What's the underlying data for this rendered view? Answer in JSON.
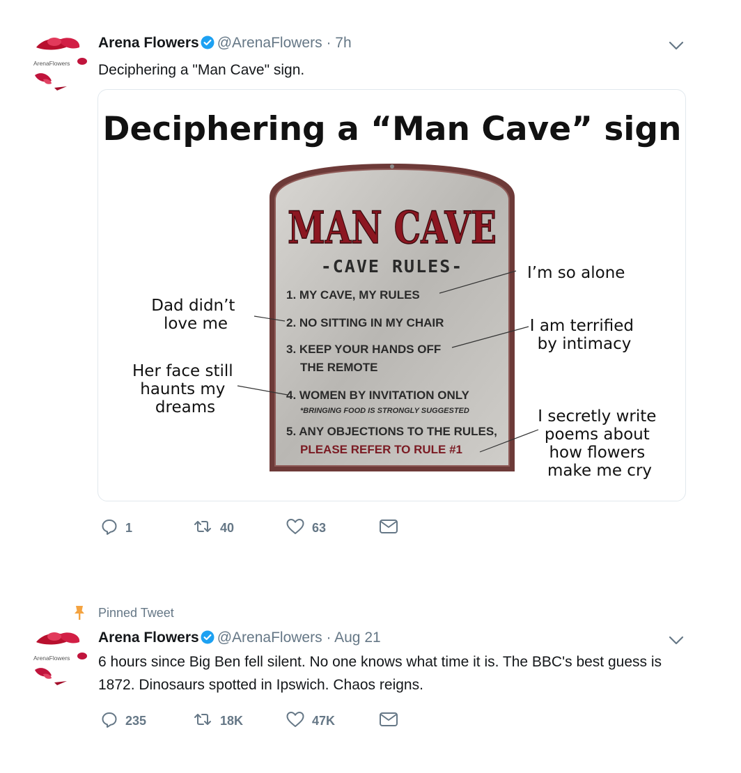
{
  "tweets": [
    {
      "account": {
        "name": "Arena Flowers",
        "handle": "@ArenaFlowers",
        "avatar_logo_text": "ArenaFlowers"
      },
      "time": "7h",
      "text": "Deciphering a \"Man Cave\" sign.",
      "media": {
        "title": "Deciphering a “Man Cave” sign",
        "sign": {
          "heading": "MAN CAVE",
          "subheading": "-CAVE RULES-",
          "rules": [
            "1. MY CAVE, MY RULES",
            "2. NO SITTING IN MY CHAIR",
            "3. KEEP YOUR HANDS OFF",
            "THE REMOTE",
            "4. WOMEN BY INVITATION ONLY",
            "*BRINGING FOOD IS STRONGLY SUGGESTED",
            "5. ANY OBJECTIONS TO THE RULES,",
            "PLEASE REFER TO RULE #1"
          ]
        },
        "annotations": {
          "left1": [
            "Dad didn’t",
            "love me"
          ],
          "left2": [
            "Her face still",
            "haunts my",
            "dreams"
          ],
          "right1": [
            "I’m so alone"
          ],
          "right2": [
            "I am terrified",
            "by intimacy"
          ],
          "right3": [
            "I secretly write",
            "poems about",
            "how flowers",
            "make me cry"
          ]
        }
      },
      "stats": {
        "replies": "1",
        "retweets": "40",
        "likes": "63"
      }
    },
    {
      "pinned_label": "Pinned Tweet",
      "account": {
        "name": "Arena Flowers",
        "handle": "@ArenaFlowers",
        "avatar_logo_text": "ArenaFlowers"
      },
      "time": "Aug 21",
      "text": "6 hours since Big Ben fell silent. No one knows what time it is. The BBC's best guess is 1872. Dinosaurs spotted in Ipswich. Chaos reigns.",
      "stats": {
        "replies": "235",
        "retweets": "18K",
        "likes": "47K"
      }
    }
  ],
  "separator": "·",
  "icons": {
    "verified": "verified-badge-icon",
    "caret": "chevron-down-icon",
    "reply": "reply-icon",
    "retweet": "retweet-icon",
    "like": "heart-icon",
    "dm": "envelope-icon",
    "pin": "pin-icon"
  },
  "colors": {
    "text_primary": "#14171a",
    "text_secondary": "#657786",
    "verified_blue": "#1da1f2",
    "pin_orange": "#f4a340",
    "border": "#e1e8ed",
    "logo_red": "#c0143c"
  }
}
